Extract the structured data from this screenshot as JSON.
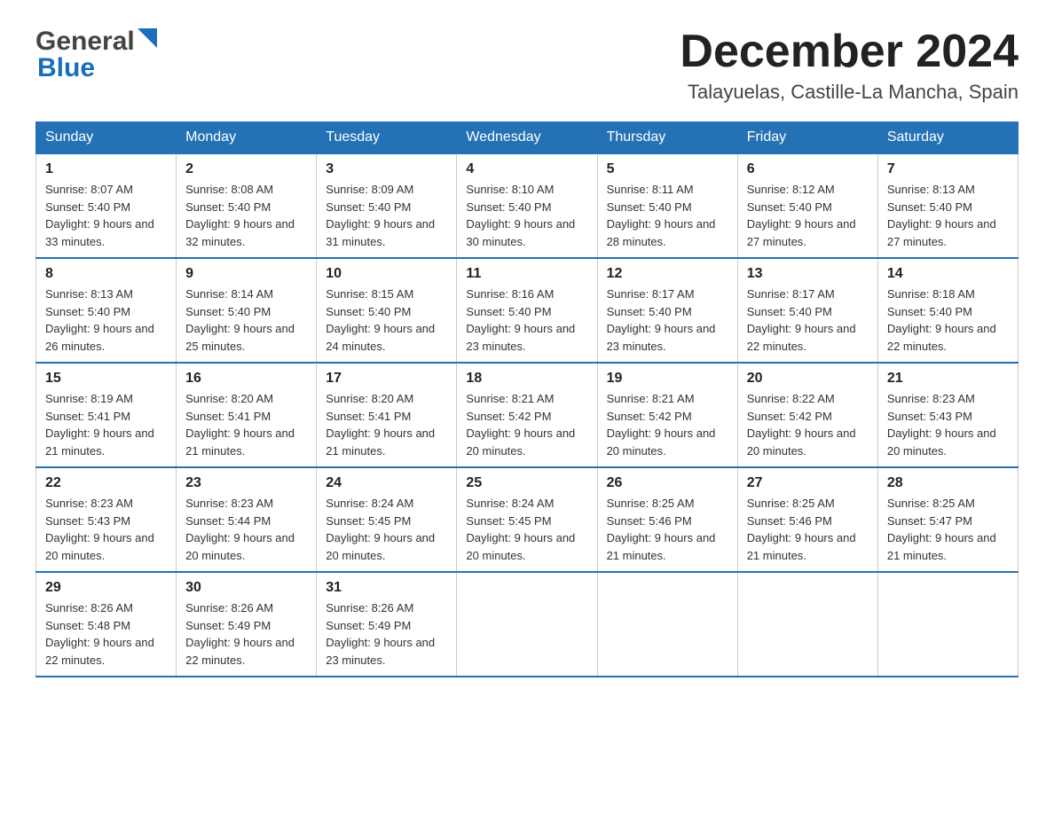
{
  "header": {
    "month_title": "December 2024",
    "location": "Talayuelas, Castille-La Mancha, Spain",
    "logo_general": "General",
    "logo_blue": "Blue"
  },
  "days_of_week": [
    "Sunday",
    "Monday",
    "Tuesday",
    "Wednesday",
    "Thursday",
    "Friday",
    "Saturday"
  ],
  "weeks": [
    [
      {
        "day": "1",
        "sunrise": "8:07 AM",
        "sunset": "5:40 PM",
        "daylight": "9 hours and 33 minutes."
      },
      {
        "day": "2",
        "sunrise": "8:08 AM",
        "sunset": "5:40 PM",
        "daylight": "9 hours and 32 minutes."
      },
      {
        "day": "3",
        "sunrise": "8:09 AM",
        "sunset": "5:40 PM",
        "daylight": "9 hours and 31 minutes."
      },
      {
        "day": "4",
        "sunrise": "8:10 AM",
        "sunset": "5:40 PM",
        "daylight": "9 hours and 30 minutes."
      },
      {
        "day": "5",
        "sunrise": "8:11 AM",
        "sunset": "5:40 PM",
        "daylight": "9 hours and 28 minutes."
      },
      {
        "day": "6",
        "sunrise": "8:12 AM",
        "sunset": "5:40 PM",
        "daylight": "9 hours and 27 minutes."
      },
      {
        "day": "7",
        "sunrise": "8:13 AM",
        "sunset": "5:40 PM",
        "daylight": "9 hours and 27 minutes."
      }
    ],
    [
      {
        "day": "8",
        "sunrise": "8:13 AM",
        "sunset": "5:40 PM",
        "daylight": "9 hours and 26 minutes."
      },
      {
        "day": "9",
        "sunrise": "8:14 AM",
        "sunset": "5:40 PM",
        "daylight": "9 hours and 25 minutes."
      },
      {
        "day": "10",
        "sunrise": "8:15 AM",
        "sunset": "5:40 PM",
        "daylight": "9 hours and 24 minutes."
      },
      {
        "day": "11",
        "sunrise": "8:16 AM",
        "sunset": "5:40 PM",
        "daylight": "9 hours and 23 minutes."
      },
      {
        "day": "12",
        "sunrise": "8:17 AM",
        "sunset": "5:40 PM",
        "daylight": "9 hours and 23 minutes."
      },
      {
        "day": "13",
        "sunrise": "8:17 AM",
        "sunset": "5:40 PM",
        "daylight": "9 hours and 22 minutes."
      },
      {
        "day": "14",
        "sunrise": "8:18 AM",
        "sunset": "5:40 PM",
        "daylight": "9 hours and 22 minutes."
      }
    ],
    [
      {
        "day": "15",
        "sunrise": "8:19 AM",
        "sunset": "5:41 PM",
        "daylight": "9 hours and 21 minutes."
      },
      {
        "day": "16",
        "sunrise": "8:20 AM",
        "sunset": "5:41 PM",
        "daylight": "9 hours and 21 minutes."
      },
      {
        "day": "17",
        "sunrise": "8:20 AM",
        "sunset": "5:41 PM",
        "daylight": "9 hours and 21 minutes."
      },
      {
        "day": "18",
        "sunrise": "8:21 AM",
        "sunset": "5:42 PM",
        "daylight": "9 hours and 20 minutes."
      },
      {
        "day": "19",
        "sunrise": "8:21 AM",
        "sunset": "5:42 PM",
        "daylight": "9 hours and 20 minutes."
      },
      {
        "day": "20",
        "sunrise": "8:22 AM",
        "sunset": "5:42 PM",
        "daylight": "9 hours and 20 minutes."
      },
      {
        "day": "21",
        "sunrise": "8:23 AM",
        "sunset": "5:43 PM",
        "daylight": "9 hours and 20 minutes."
      }
    ],
    [
      {
        "day": "22",
        "sunrise": "8:23 AM",
        "sunset": "5:43 PM",
        "daylight": "9 hours and 20 minutes."
      },
      {
        "day": "23",
        "sunrise": "8:23 AM",
        "sunset": "5:44 PM",
        "daylight": "9 hours and 20 minutes."
      },
      {
        "day": "24",
        "sunrise": "8:24 AM",
        "sunset": "5:45 PM",
        "daylight": "9 hours and 20 minutes."
      },
      {
        "day": "25",
        "sunrise": "8:24 AM",
        "sunset": "5:45 PM",
        "daylight": "9 hours and 20 minutes."
      },
      {
        "day": "26",
        "sunrise": "8:25 AM",
        "sunset": "5:46 PM",
        "daylight": "9 hours and 21 minutes."
      },
      {
        "day": "27",
        "sunrise": "8:25 AM",
        "sunset": "5:46 PM",
        "daylight": "9 hours and 21 minutes."
      },
      {
        "day": "28",
        "sunrise": "8:25 AM",
        "sunset": "5:47 PM",
        "daylight": "9 hours and 21 minutes."
      }
    ],
    [
      {
        "day": "29",
        "sunrise": "8:26 AM",
        "sunset": "5:48 PM",
        "daylight": "9 hours and 22 minutes."
      },
      {
        "day": "30",
        "sunrise": "8:26 AM",
        "sunset": "5:49 PM",
        "daylight": "9 hours and 22 minutes."
      },
      {
        "day": "31",
        "sunrise": "8:26 AM",
        "sunset": "5:49 PM",
        "daylight": "9 hours and 23 minutes."
      },
      null,
      null,
      null,
      null
    ]
  ]
}
